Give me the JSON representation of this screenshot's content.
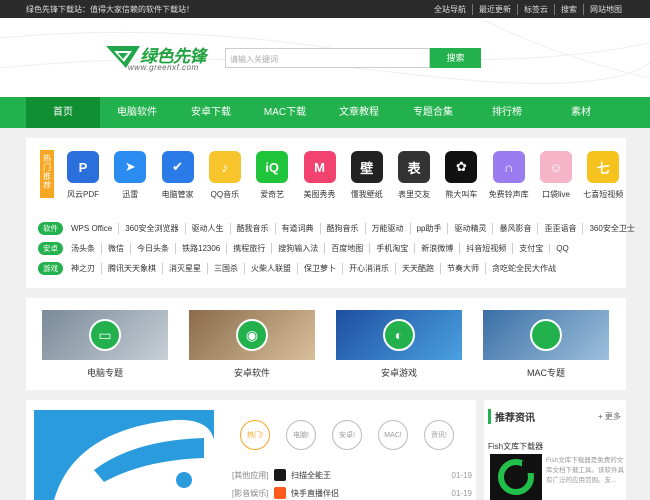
{
  "topbar": {
    "tagline": "绿色先锋下载站：值得大家信赖的软件下载站！",
    "links": [
      "全站导航",
      "最近更新",
      "标签云",
      "搜索",
      "网站地图"
    ]
  },
  "logo": {
    "brand": "绿色先锋",
    "url": "www.greenxf.com"
  },
  "search": {
    "placeholder": "请输入关键词",
    "button": "搜索"
  },
  "nav": [
    "首页",
    "电脑软件",
    "安卓下载",
    "MAC下载",
    "文章教程",
    "专题合集",
    "排行榜",
    "素材"
  ],
  "hot": {
    "tag": "热门推荐",
    "apps": [
      {
        "name": "风云PDF",
        "icon": "pdf-icon",
        "color": "#2a6fdb",
        "glyph": "P"
      },
      {
        "name": "迅雷",
        "icon": "thunder-icon",
        "color": "#2a8cf0",
        "glyph": "➤"
      },
      {
        "name": "电脑管家",
        "icon": "shield-icon",
        "color": "#2a7be8",
        "glyph": "✔"
      },
      {
        "name": "QQ音乐",
        "icon": "music-icon",
        "color": "#f7c52b",
        "glyph": "♪"
      },
      {
        "name": "爱奇艺",
        "icon": "iqiyi-icon",
        "color": "#1fc43b",
        "glyph": "iQ"
      },
      {
        "name": "美图秀秀",
        "icon": "meitu-icon",
        "color": "#f2426e",
        "glyph": "M"
      },
      {
        "name": "懂我壁纸",
        "icon": "wallpaper-icon",
        "color": "#222222",
        "glyph": "壁"
      },
      {
        "name": "表里交友",
        "icon": "biaoli-icon",
        "color": "#333333",
        "glyph": "表"
      },
      {
        "name": "熊大叫车",
        "icon": "bear-icon",
        "color": "#111111",
        "glyph": "✿"
      },
      {
        "name": "免费铃声库",
        "icon": "headphone-icon",
        "color": "#9a7cf0",
        "glyph": "∩"
      },
      {
        "name": "口袋live",
        "icon": "pocket-icon",
        "color": "#f5b4c8",
        "glyph": "☺"
      },
      {
        "name": "七喜短视频",
        "icon": "video-icon",
        "color": "#f5c21e",
        "glyph": "七"
      }
    ]
  },
  "categories": [
    {
      "tag": "软件",
      "links": [
        "WPS Office",
        "360安全浏览器",
        "驱动人生",
        "酷我音乐",
        "有道词典",
        "酷狗音乐",
        "万能驱动",
        "pp助手",
        "驱动精灵",
        "暴风影音",
        "歪歪语音",
        "360安全卫士"
      ]
    },
    {
      "tag": "安卓",
      "links": [
        "汤头条",
        "微信",
        "今日头条",
        "铁路12306",
        "携程旅行",
        "搜狗输入法",
        "百度地图",
        "手机淘宝",
        "新浪微博",
        "抖音短视频",
        "支付宝",
        "QQ"
      ]
    },
    {
      "tag": "游戏",
      "links": [
        "神之刃",
        "腾讯天天象棋",
        "消灭星星",
        "三国杀",
        "火柴人联盟",
        "保卫萝卜",
        "开心消消乐",
        "天天酷跑",
        "节奏大师",
        "贪吃蛇全民大作战"
      ]
    }
  ],
  "topics": [
    {
      "label": "电脑专题",
      "icon": "monitor-icon",
      "glyph": "▭"
    },
    {
      "label": "安卓软件",
      "icon": "android-icon",
      "glyph": "◉"
    },
    {
      "label": "安卓游戏",
      "icon": "gamepad-icon",
      "glyph": "◐"
    },
    {
      "label": "MAC专题",
      "icon": "apple-icon",
      "glyph": ""
    }
  ],
  "bubbles": [
    "热门!",
    "电脑!",
    "安卓!",
    "MAC!",
    "资讯!"
  ],
  "list": [
    {
      "cat": "[其他应用]",
      "title": "扫描全能王",
      "date": "01-19",
      "icon": "camscanner-icon",
      "color": "#1a1a1a"
    },
    {
      "cat": "[影音娱乐]",
      "title": "快手直播伴侣",
      "date": "01-19",
      "icon": "kuaishou-icon",
      "color": "#ff5a1e"
    }
  ],
  "recommend": {
    "title": "推荐资讯",
    "more": "+ 更多",
    "item_title": "Fish文库下载器",
    "item_desc": "Fish文库下载器是免费的文库文档下载工具。该软件具有广泛的应用范围。支..."
  }
}
